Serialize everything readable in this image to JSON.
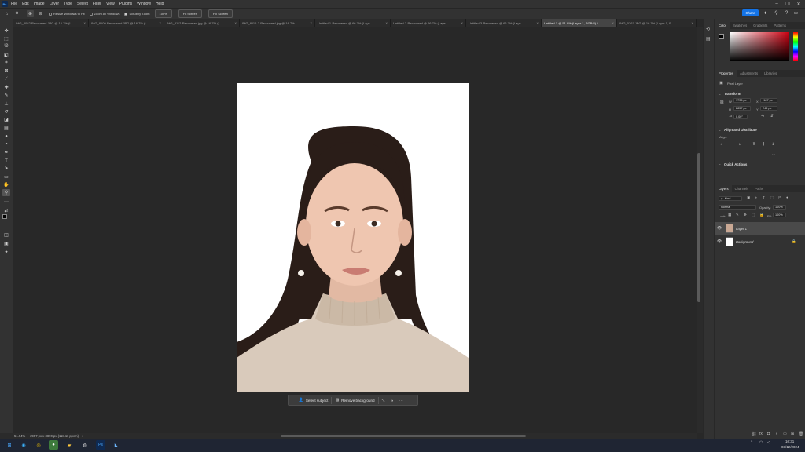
{
  "app": {
    "logo": "Ps"
  },
  "menu": [
    "File",
    "Edit",
    "Image",
    "Layer",
    "Type",
    "Select",
    "Filter",
    "View",
    "Plugins",
    "Window",
    "Help"
  ],
  "window_controls": {
    "minimize": "–",
    "restore": "❐",
    "close": "✕"
  },
  "options_bar": {
    "resize_windows_label": "Resize Windows to Fit",
    "zoom_all_label": "Zoom All Windows",
    "scrubby_zoom_label": "Scrubby Zoom",
    "zoom_100_label": "100%",
    "fit_screen_label": "Fit Screen",
    "fill_screen_label": "Fill Screen",
    "share_label": "Share"
  },
  "tabs": [
    {
      "label": "IMG_8082-Recovered.JPG @ 16.7% (L...",
      "active": false
    },
    {
      "label": "IMG_8109-Recovered.JPG @ 16.7% (L...",
      "active": false
    },
    {
      "label": "IMG_8112-Recovered.jpg @ 16.7% (L...",
      "active": false
    },
    {
      "label": "IMG_8116-2-Recovered.jpg @ 16.7% ...",
      "active": false
    },
    {
      "label": "Untitled-1-Recovered @ 66.7% (Laye...",
      "active": false
    },
    {
      "label": "Untitled-2-Recovered @ 66.7% (Laye...",
      "active": false
    },
    {
      "label": "Untitled-3-Recovered @ 66.7% (Laye...",
      "active": false
    },
    {
      "label": "Untitled-1 @ 51.9% (Layer 1, RGB/8) *",
      "active": true
    },
    {
      "label": "IMG_0267.JPG @ 16.7% (Layer 1, R...",
      "active": false
    }
  ],
  "context_taskbar": {
    "select_subject": "Select subject",
    "remove_background": "Remove background",
    "more": "···"
  },
  "status": {
    "zoom": "51.94%",
    "doc_info": "2957 px x 3890 px (118.11 ppcm)"
  },
  "color_panel": {
    "tabs": [
      "Color",
      "Swatches",
      "Gradients",
      "Patterns"
    ],
    "active_tab": "Color",
    "hue_base": "#cc0010"
  },
  "properties_panel": {
    "tabs": [
      "Properties",
      "Adjustments",
      "Libraries"
    ],
    "active_tab": "Properties",
    "layer_type": "Pixel Layer",
    "transform_title": "Transform",
    "w_label": "W",
    "w_value": "1736 px",
    "h_label": "H",
    "h_value": "2857 px",
    "x_label": "X",
    "x_value": "-187 px",
    "y_label": "Y",
    "y_value": "246 px",
    "angle_value": "0.00°",
    "align_title": "Align and Distribute",
    "align_sub": "Align:",
    "quick_actions_title": "Quick Actions"
  },
  "layers_panel": {
    "tabs": [
      "Layers",
      "Channels",
      "Paths"
    ],
    "active_tab": "Layers",
    "filter_label": "Kind",
    "blend_mode": "Normal",
    "opacity_label": "Opacity:",
    "opacity_value": "100%",
    "lock_label": "Lock:",
    "fill_label": "Fill:",
    "fill_value": "100%",
    "layers": [
      {
        "name": "Layer 1",
        "selected": true
      },
      {
        "name": "Background",
        "selected": false
      }
    ]
  },
  "os_taskbar": {
    "time": "10:31",
    "date": "03/12/2024"
  }
}
